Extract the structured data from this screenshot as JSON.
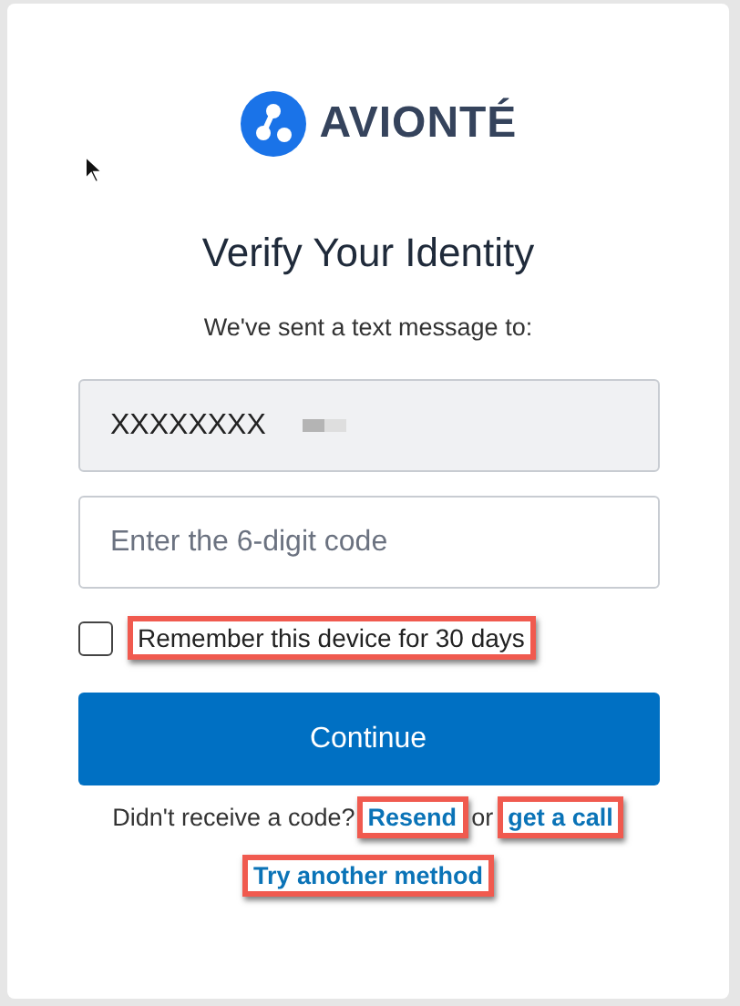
{
  "logo": {
    "name": "AVIONTÉ"
  },
  "title": "Verify Your Identity",
  "subtitle": "We've sent a text message to:",
  "phone_field": {
    "value": "XXXXXXXX",
    "disabled": true
  },
  "code_field": {
    "placeholder": "Enter the 6-digit code"
  },
  "remember": {
    "label": "Remember this device for 30 days",
    "checked": false,
    "highlighted": true
  },
  "continue_button": "Continue",
  "resend_row": {
    "prompt": "Didn't receive a code?",
    "links": [
      {
        "label": "Resend",
        "highlighted": true
      },
      {
        "label": "get a call",
        "highlighted": true
      }
    ],
    "separator": "or"
  },
  "other_method": {
    "label": "Try another method",
    "highlighted": true
  }
}
